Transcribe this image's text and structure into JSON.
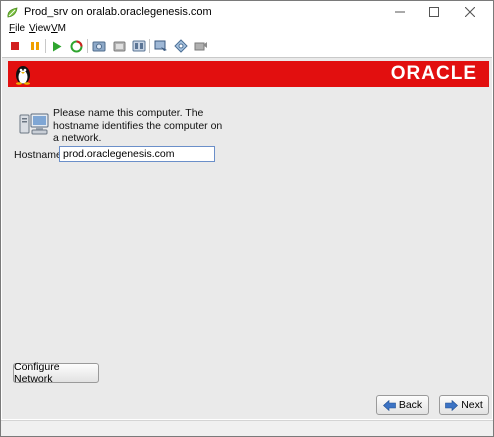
{
  "window": {
    "title": "Prod_srv on oralab.oraclegenesis.com",
    "controls": {
      "minimize": "—",
      "maximize": "☐",
      "close": "✕"
    }
  },
  "menu": {
    "items": [
      {
        "label": "File"
      },
      {
        "label": "View"
      },
      {
        "label": "VM"
      }
    ]
  },
  "toolbar": {
    "buttons": [
      {
        "name": "power-off",
        "icon": "stop-icon"
      },
      {
        "name": "suspend",
        "icon": "pause-icon"
      },
      {
        "name": "power-on",
        "icon": "play-icon"
      },
      {
        "name": "reset",
        "icon": "reset-icon"
      },
      {
        "name": "snapshot",
        "icon": "snapshot-icon"
      },
      {
        "name": "revert",
        "icon": "revert-icon"
      },
      {
        "name": "manage-snapshots",
        "icon": "snapshot-manager-icon"
      },
      {
        "name": "console",
        "icon": "console-icon"
      },
      {
        "name": "edit-settings",
        "icon": "settings-icon"
      },
      {
        "name": "send-ctrl-alt-del",
        "icon": "keyboard-icon"
      }
    ],
    "colors": {
      "stop": "#d21f1f",
      "pause": "#f0a000",
      "play": "#2fa52f"
    }
  },
  "installer": {
    "banner": {
      "logo_text": "ORACLE",
      "color": "#e20f0f"
    },
    "intro": "Please name this computer.  The hostname identifies the computer on a network.",
    "hostname_label": "Hostname:",
    "hostname_value": "prod.oraclegenesis.com",
    "configure_network_label": "Configure Network",
    "back_label": "Back",
    "next_label": "Next"
  }
}
